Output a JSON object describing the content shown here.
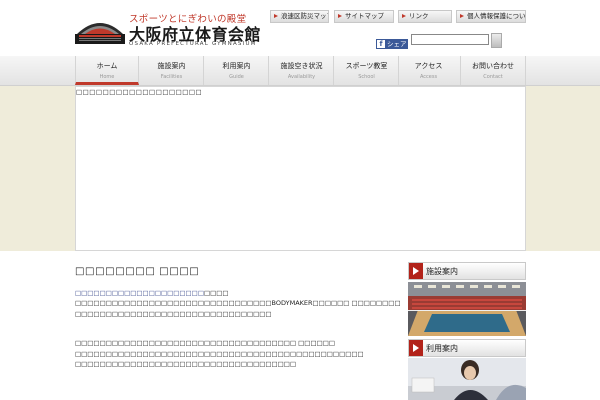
{
  "header": {
    "tagline": "スポーツとにぎわいの殿堂",
    "name": "大阪府立体育会館",
    "name_en": "OSAKA PREFECTURAL GYMNASIUM",
    "util_links": [
      "浪速区防災マップ",
      "サイトマップ",
      "リンク",
      "個人情報保護について"
    ],
    "share_label": "シェア",
    "search_value": ""
  },
  "nav": [
    {
      "jp": "ホーム",
      "en": "Home"
    },
    {
      "jp": "施設案内",
      "en": "Facilities"
    },
    {
      "jp": "利用案内",
      "en": "Guide"
    },
    {
      "jp": "施設空き状況",
      "en": "Availability"
    },
    {
      "jp": "スポーツ教室",
      "en": "School"
    },
    {
      "jp": "アクセス",
      "en": "Access"
    },
    {
      "jp": "お問い合わせ",
      "en": "Contact"
    }
  ],
  "main": {
    "frame_text": "□□□□□□□□□□□□□□□□□□□",
    "title": "□□□□□□□□ □□□□",
    "subtitle": "□□□□□□□□□□□□□□□□□□□□□",
    "subtitle_tail": "□□□□",
    "para1": [
      "□□□□□□□□□□□□□□□□□□□□□□□□□□□□□□□□BODYMAKER□□□□□□ □□□□□□□□□□□□□□□□□□ □□□□□□□□□□",
      "□□□□□□□□□□□□□□□□□□□□□□□□□□□□□□□□"
    ],
    "para2": [
      "□□□□□□□□□□□□□□□□□□□□□□□□□□□□□□□□□□□□ □□□□□□",
      "□□□□□□□□□□□□□□□□□□□□□□□□□□□□□□□□□□□□□□□□□□□□□□□",
      "□□□□□□□□□□□□□□□□□□□□□□□□□□□□□□□□□□□□"
    ]
  },
  "sidebar": {
    "items": [
      {
        "label": "施設案内"
      },
      {
        "label": "利用案内"
      }
    ]
  },
  "colors": {
    "accent": "#c0392b",
    "band": "#efecda",
    "link": "#3b4a8c",
    "facebook": "#3b5998"
  }
}
